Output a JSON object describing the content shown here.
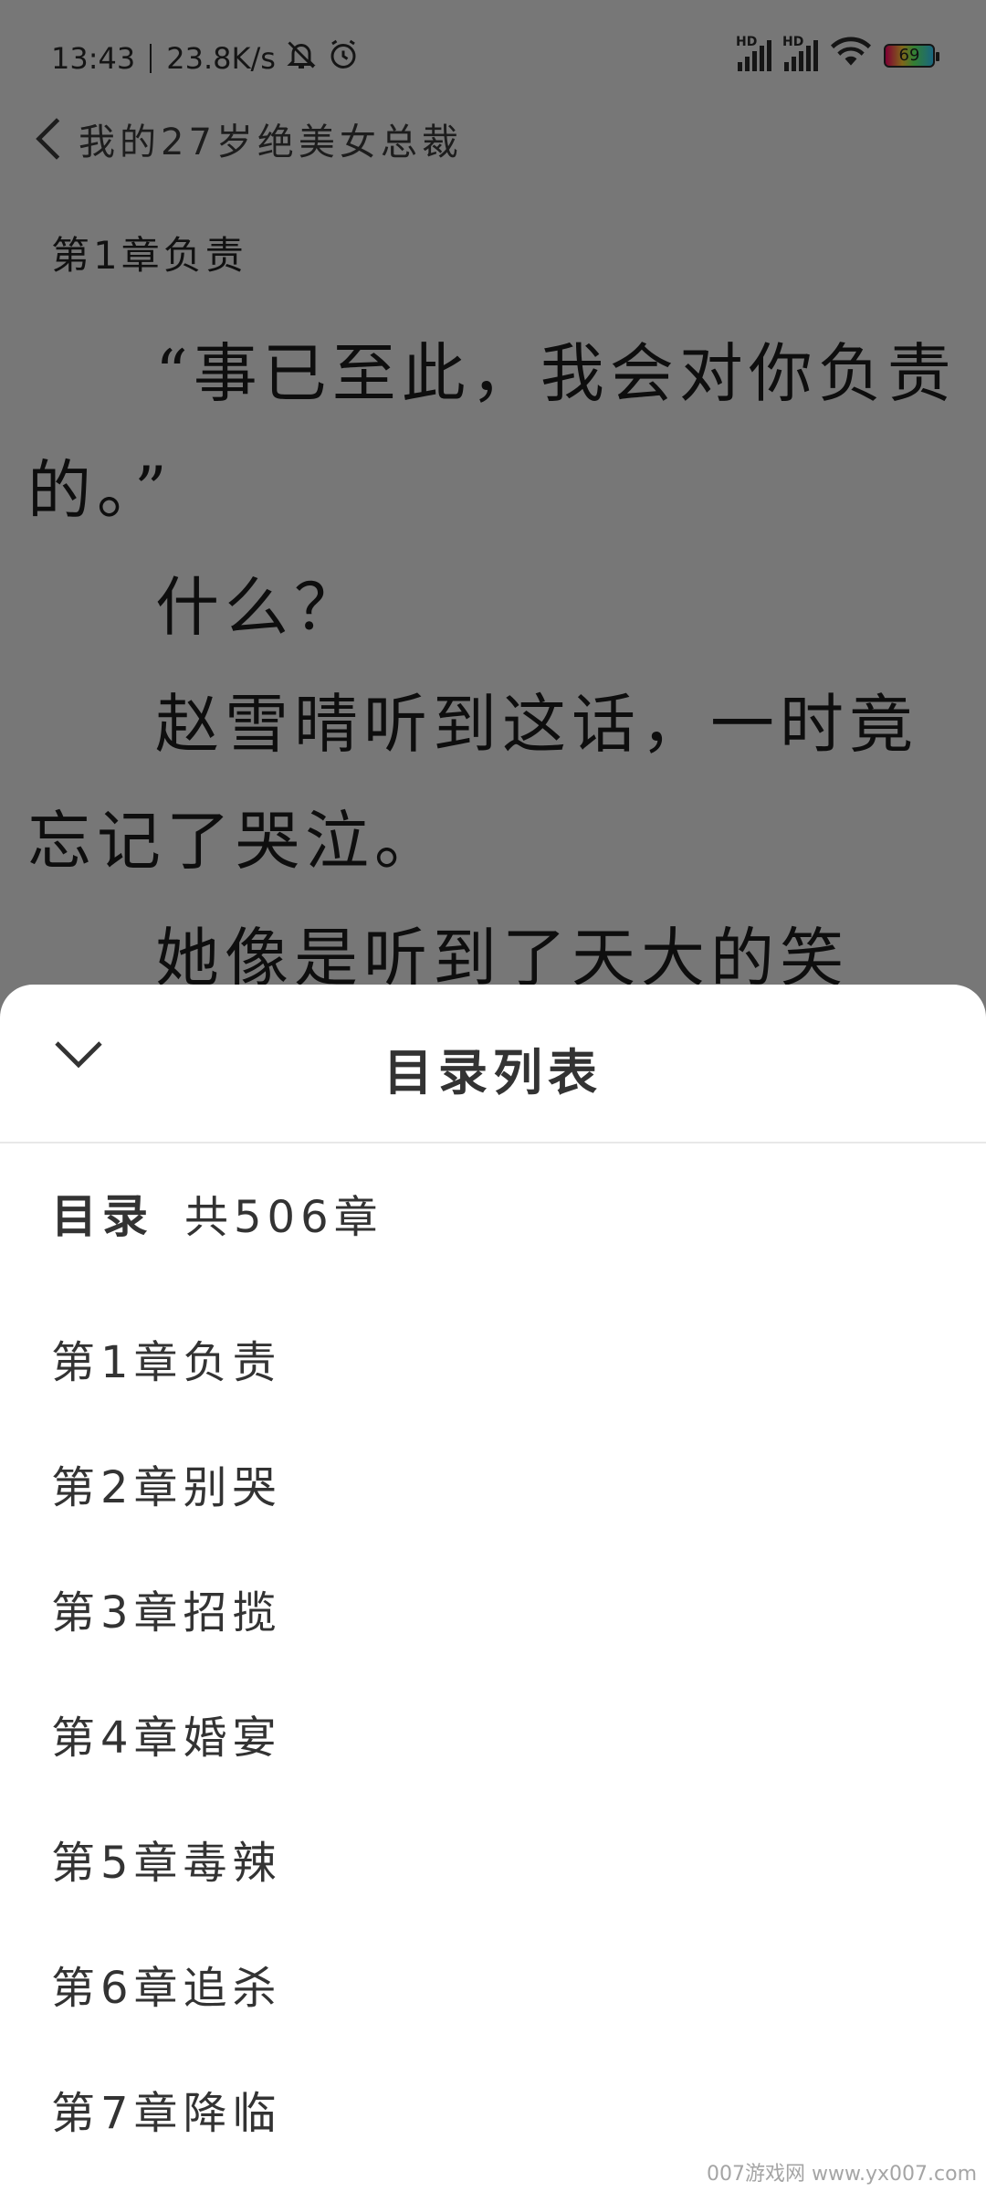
{
  "status_bar": {
    "time": "13:43",
    "net_speed": "23.8K/s",
    "battery_level": "69",
    "hd1": "HD",
    "hd2": "HD"
  },
  "reader": {
    "book_title": "我的27岁绝美女总裁",
    "chapter_heading": "第1章负责",
    "paragraphs": [
      "“事已至此，我会对你负责的。”",
      "什么？",
      "赵雪晴听到这话，一时竟忘记了哭泣。",
      "她像是听到了天大的笑"
    ]
  },
  "toc_sheet": {
    "title": "目录列表",
    "label": "目录",
    "count": "共506章",
    "chapters": [
      "第1章负责",
      "第2章别哭",
      "第3章招揽",
      "第4章婚宴",
      "第5章毒辣",
      "第6章追杀",
      "第7章降临"
    ]
  },
  "watermark": "007游戏网 www.yx007.com"
}
